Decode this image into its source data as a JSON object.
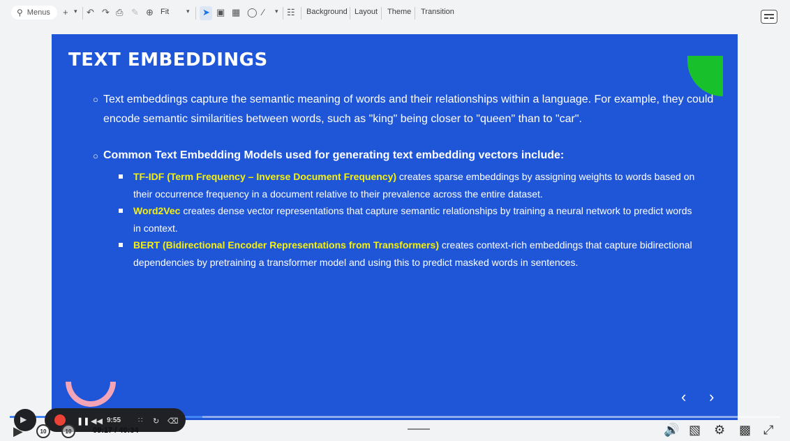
{
  "toolbar": {
    "search_label": "Menus",
    "zoom_label": "Fit",
    "background_label": "Background",
    "layout_label": "Layout",
    "theme_label": "Theme",
    "transition_label": "Transition"
  },
  "slide": {
    "title": "TEXT EMBEDDINGS",
    "paragraph": "Text embeddings capture the semantic meaning of words and their relationships within a language. For example, they could encode semantic similarities between words, such as \"king\" being closer to \"queen\" than to \"car\".",
    "heading": "Common Text Embedding Models used for generating text embedding vectors include:",
    "items": [
      {
        "term": "TF-IDF (Term Frequency – Inverse Document Frequency)",
        "text": " creates sparse embeddings by assigning weights to words based on their occurrence frequency in a document relative to their prevalence across the entire dataset."
      },
      {
        "term": "Word2Vec",
        "text": " creates dense vector representations that capture semantic relationships by training a neural network to predict words in context."
      },
      {
        "term": "BERT (Bidirectional Encoder Representations from Transformers)",
        "text": " creates context-rich embeddings that capture bidirectional dependencies by pretraining a transformer model and using this to predict masked words in sentences."
      }
    ],
    "colors": {
      "background": "#1f56d8",
      "highlight": "#f7f00a",
      "accent_green": "#18c12b",
      "accent_pink": "#f4a4b7"
    }
  },
  "player": {
    "recording_time": "9:55",
    "time_display": "09:17 / 40:34",
    "skip_back": "10",
    "skip_forward": "10",
    "progress": 0.23
  }
}
